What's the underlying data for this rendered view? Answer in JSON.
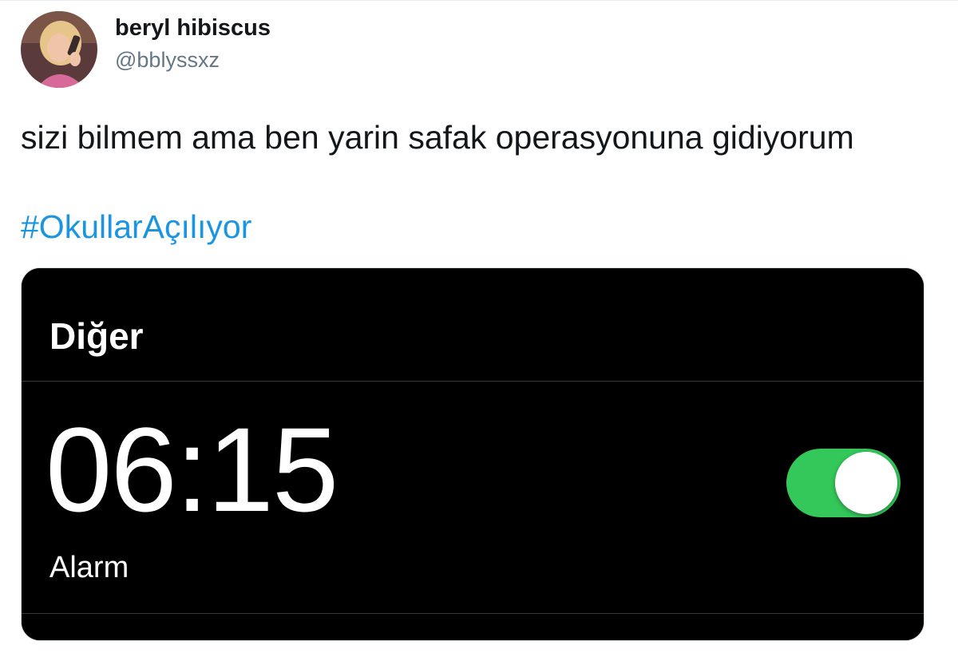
{
  "tweet": {
    "author": {
      "display_name": "beryl hibiscus",
      "handle": "@bblyssxz"
    },
    "text": "sizi bilmem ama ben yarin safak operasyonuna gidiyorum",
    "hashtag": "#OkullarAçılıyor",
    "colors": {
      "text": "#14171a",
      "secondary": "#657786",
      "link": "#1b95e0"
    }
  },
  "media": {
    "section_title": "Diğer",
    "alarm": {
      "time": "06:15",
      "label": "Alarm",
      "enabled": true
    },
    "colors": {
      "background": "#000000",
      "toggle_on": "#34c759",
      "divider": "#38383a"
    }
  }
}
